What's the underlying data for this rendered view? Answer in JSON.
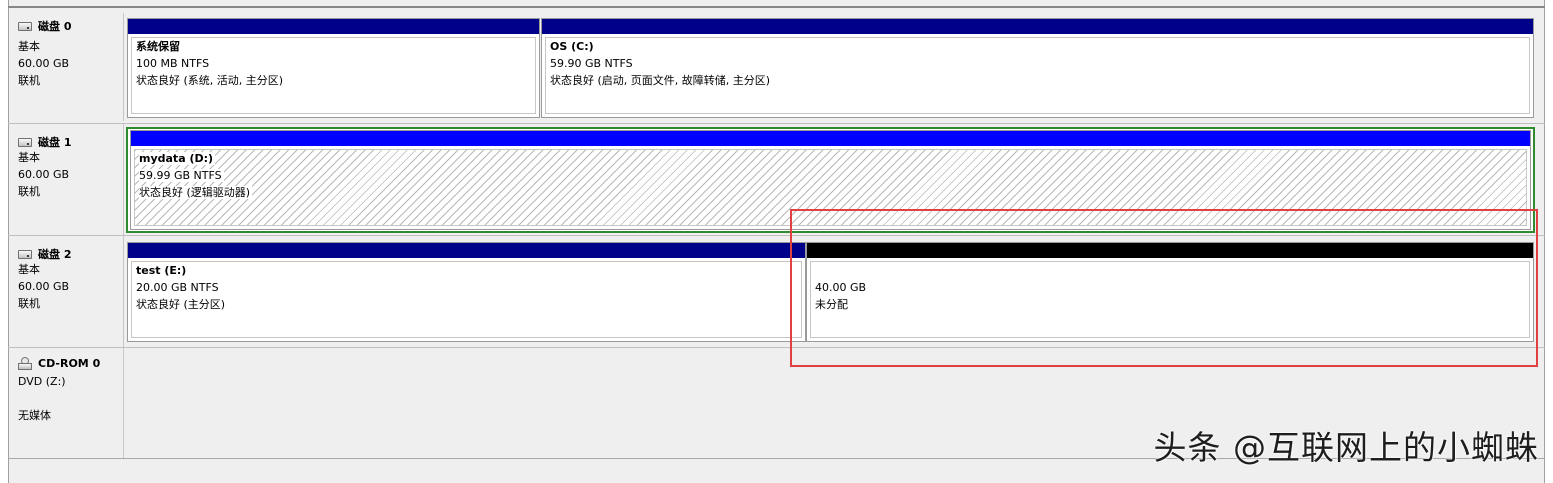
{
  "disks": [
    {
      "name": "磁盘 0",
      "type": "基本",
      "size": "60.00 GB",
      "status": "联机",
      "partitions": [
        {
          "title": "系统保留",
          "size_fs": "100 MB NTFS",
          "status": "状态良好 (系统, 活动, 主分区)",
          "bar_color": "#00008b"
        },
        {
          "title": "OS  (C:)",
          "size_fs": "59.90 GB NTFS",
          "status": "状态良好 (启动, 页面文件, 故障转储, 主分区)",
          "bar_color": "#00008b"
        }
      ]
    },
    {
      "name": "磁盘 1",
      "type": "基本",
      "size": "60.00 GB",
      "status": "联机",
      "partitions": [
        {
          "title": "mydata  (D:)",
          "size_fs": "59.99 GB NTFS",
          "status": "状态良好 (逻辑驱动器)",
          "bar_color": "#0000ff"
        }
      ]
    },
    {
      "name": "磁盘 2",
      "type": "基本",
      "size": "60.00 GB",
      "status": "联机",
      "partitions": [
        {
          "title": "test  (E:)",
          "size_fs": "20.00 GB NTFS",
          "status": "状态良好 (主分区)",
          "bar_color": "#00008b"
        },
        {
          "title": "",
          "size_fs": "40.00 GB",
          "status": "未分配",
          "bar_color": "#000000"
        }
      ]
    }
  ],
  "cdrom": {
    "name": "CD-ROM 0",
    "drive": "DVD (Z:)",
    "status": "无媒体"
  },
  "watermark": "头条 @互联网上的小蜘蛛",
  "colors": {
    "primary_bar": "#00008b",
    "logical_bar": "#0000ff",
    "unallocated_bar": "#000000",
    "extended_border": "#2e8b2e",
    "highlight": "#e04040"
  },
  "icons": {
    "disk": "hard-disk-icon",
    "cdrom": "cd-rom-icon"
  }
}
